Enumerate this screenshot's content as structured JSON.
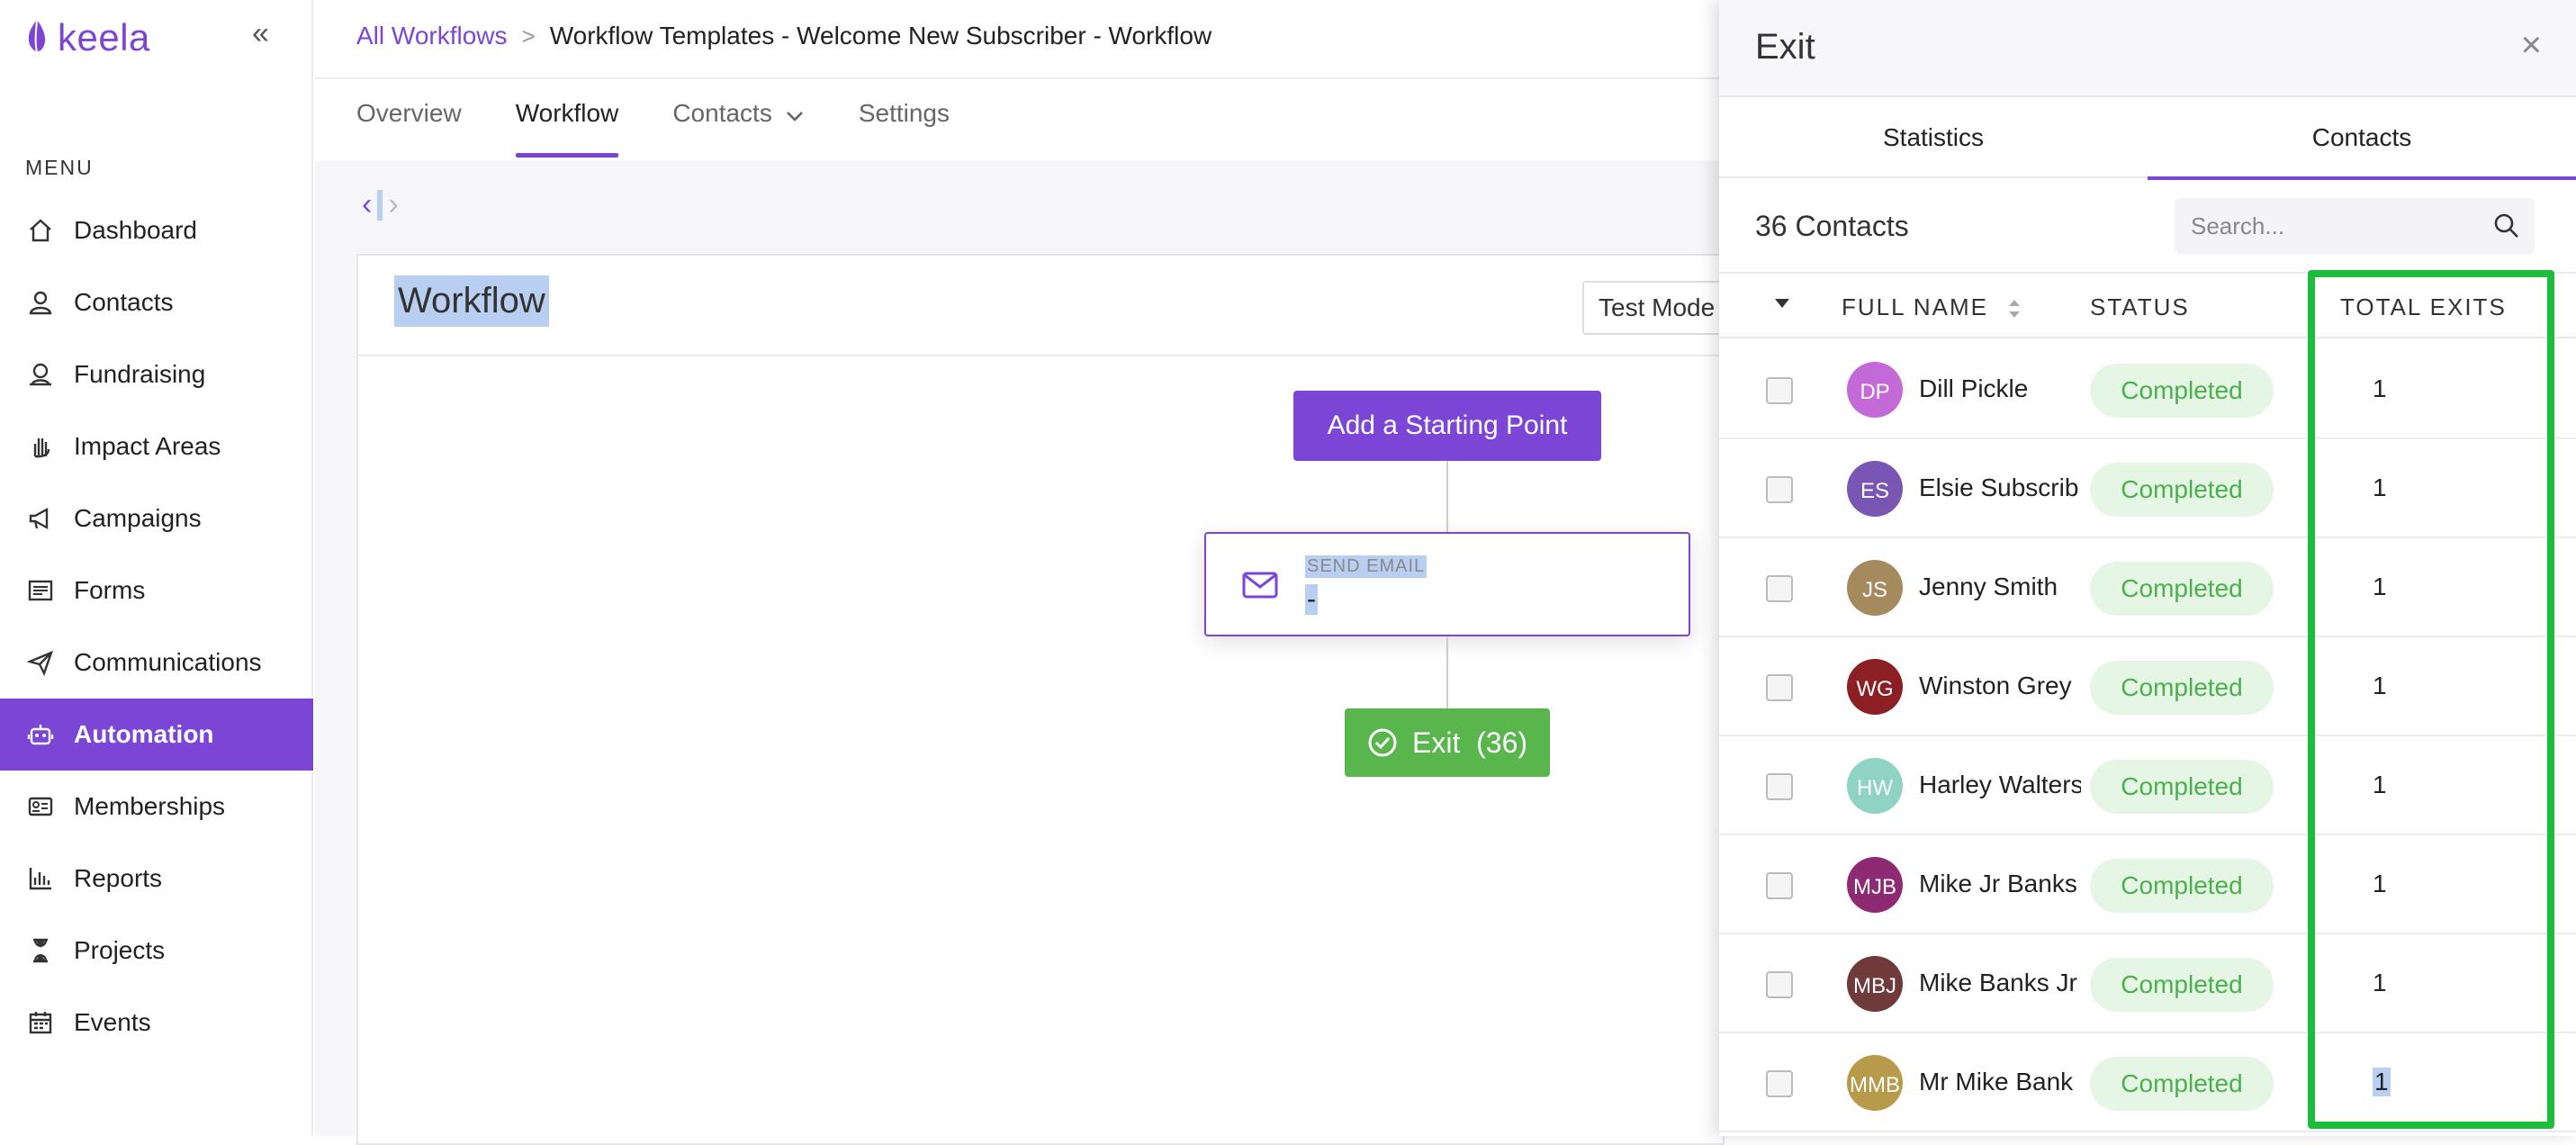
{
  "brand": {
    "name": "keela",
    "color": "#7b46d6"
  },
  "sidebar": {
    "collapse_label": "«",
    "menu_heading": "MENU",
    "items": [
      {
        "label": "Dashboard",
        "icon": "home-icon",
        "active": false
      },
      {
        "label": "Contacts",
        "icon": "person-icon",
        "active": false
      },
      {
        "label": "Fundraising",
        "icon": "donation-icon",
        "active": false
      },
      {
        "label": "Impact Areas",
        "icon": "hand-icon",
        "active": false
      },
      {
        "label": "Campaigns",
        "icon": "megaphone-icon",
        "active": false
      },
      {
        "label": "Forms",
        "icon": "form-icon",
        "active": false
      },
      {
        "label": "Communications",
        "icon": "paper-plane-icon",
        "active": false
      },
      {
        "label": "Automation",
        "icon": "robot-icon",
        "active": true
      },
      {
        "label": "Memberships",
        "icon": "id-card-icon",
        "active": false
      },
      {
        "label": "Reports",
        "icon": "bar-chart-icon",
        "active": false
      },
      {
        "label": "Projects",
        "icon": "hourglass-icon",
        "active": false
      },
      {
        "label": "Events",
        "icon": "calendar-icon",
        "active": false
      }
    ]
  },
  "breadcrumb": {
    "parent": "All Workflows",
    "separator": ">",
    "current": "Workflow Templates - Welcome New Subscriber - Workflow"
  },
  "tabs": [
    {
      "label": "Overview",
      "active": false
    },
    {
      "label": "Workflow",
      "active": true
    },
    {
      "label": "Contacts",
      "active": false,
      "has_dropdown": true
    },
    {
      "label": "Settings",
      "active": false
    }
  ],
  "nav_arrows": {
    "prev": "‹",
    "next": "›"
  },
  "workflow": {
    "title": "Workflow",
    "test_mode_label": "Test Mode",
    "start_button": "Add a Starting Point",
    "email_node": {
      "type": "SEND EMAIL",
      "value": "-"
    },
    "exit_button": "Exit  (36)"
  },
  "panel": {
    "title": "Exit",
    "close": "×",
    "tabs": [
      {
        "label": "Statistics",
        "active": false
      },
      {
        "label": "Contacts",
        "active": true
      }
    ],
    "count_label": "36 Contacts",
    "search_placeholder": "Search...",
    "columns": {
      "name": "FULL NAME",
      "status": "STATUS",
      "exits": "TOTAL EXITS"
    },
    "rows": [
      {
        "initials": "DP",
        "name": "Dill Pickle",
        "status": "Completed",
        "exits": "1",
        "color": "#c36ad8"
      },
      {
        "initials": "ES",
        "name": "Elsie Subscrib",
        "status": "Completed",
        "exits": "1",
        "color": "#7956b3"
      },
      {
        "initials": "JS",
        "name": "Jenny Smith",
        "status": "Completed",
        "exits": "1",
        "color": "#a58a5e"
      },
      {
        "initials": "WG",
        "name": "Winston Grey",
        "status": "Completed",
        "exits": "1",
        "color": "#8c1f24"
      },
      {
        "initials": "HW",
        "name": "Harley Walters",
        "status": "Completed",
        "exits": "1",
        "color": "#8fd3c4"
      },
      {
        "initials": "MJB",
        "name": "Mike Jr Banks",
        "status": "Completed",
        "exits": "1",
        "color": "#8e2a74"
      },
      {
        "initials": "MBJ",
        "name": "Mike Banks Jr",
        "status": "Completed",
        "exits": "1",
        "color": "#70393a"
      },
      {
        "initials": "MMB",
        "name": "Mr Mike Bank",
        "status": "Completed",
        "exits": "1",
        "color": "#b89a4b"
      }
    ]
  },
  "colors": {
    "accent": "#7b46d6",
    "success": "#58b64c",
    "status_bg": "#e6f6e4",
    "highlight": "#1ebc3c",
    "selection": "#b9cff2"
  }
}
